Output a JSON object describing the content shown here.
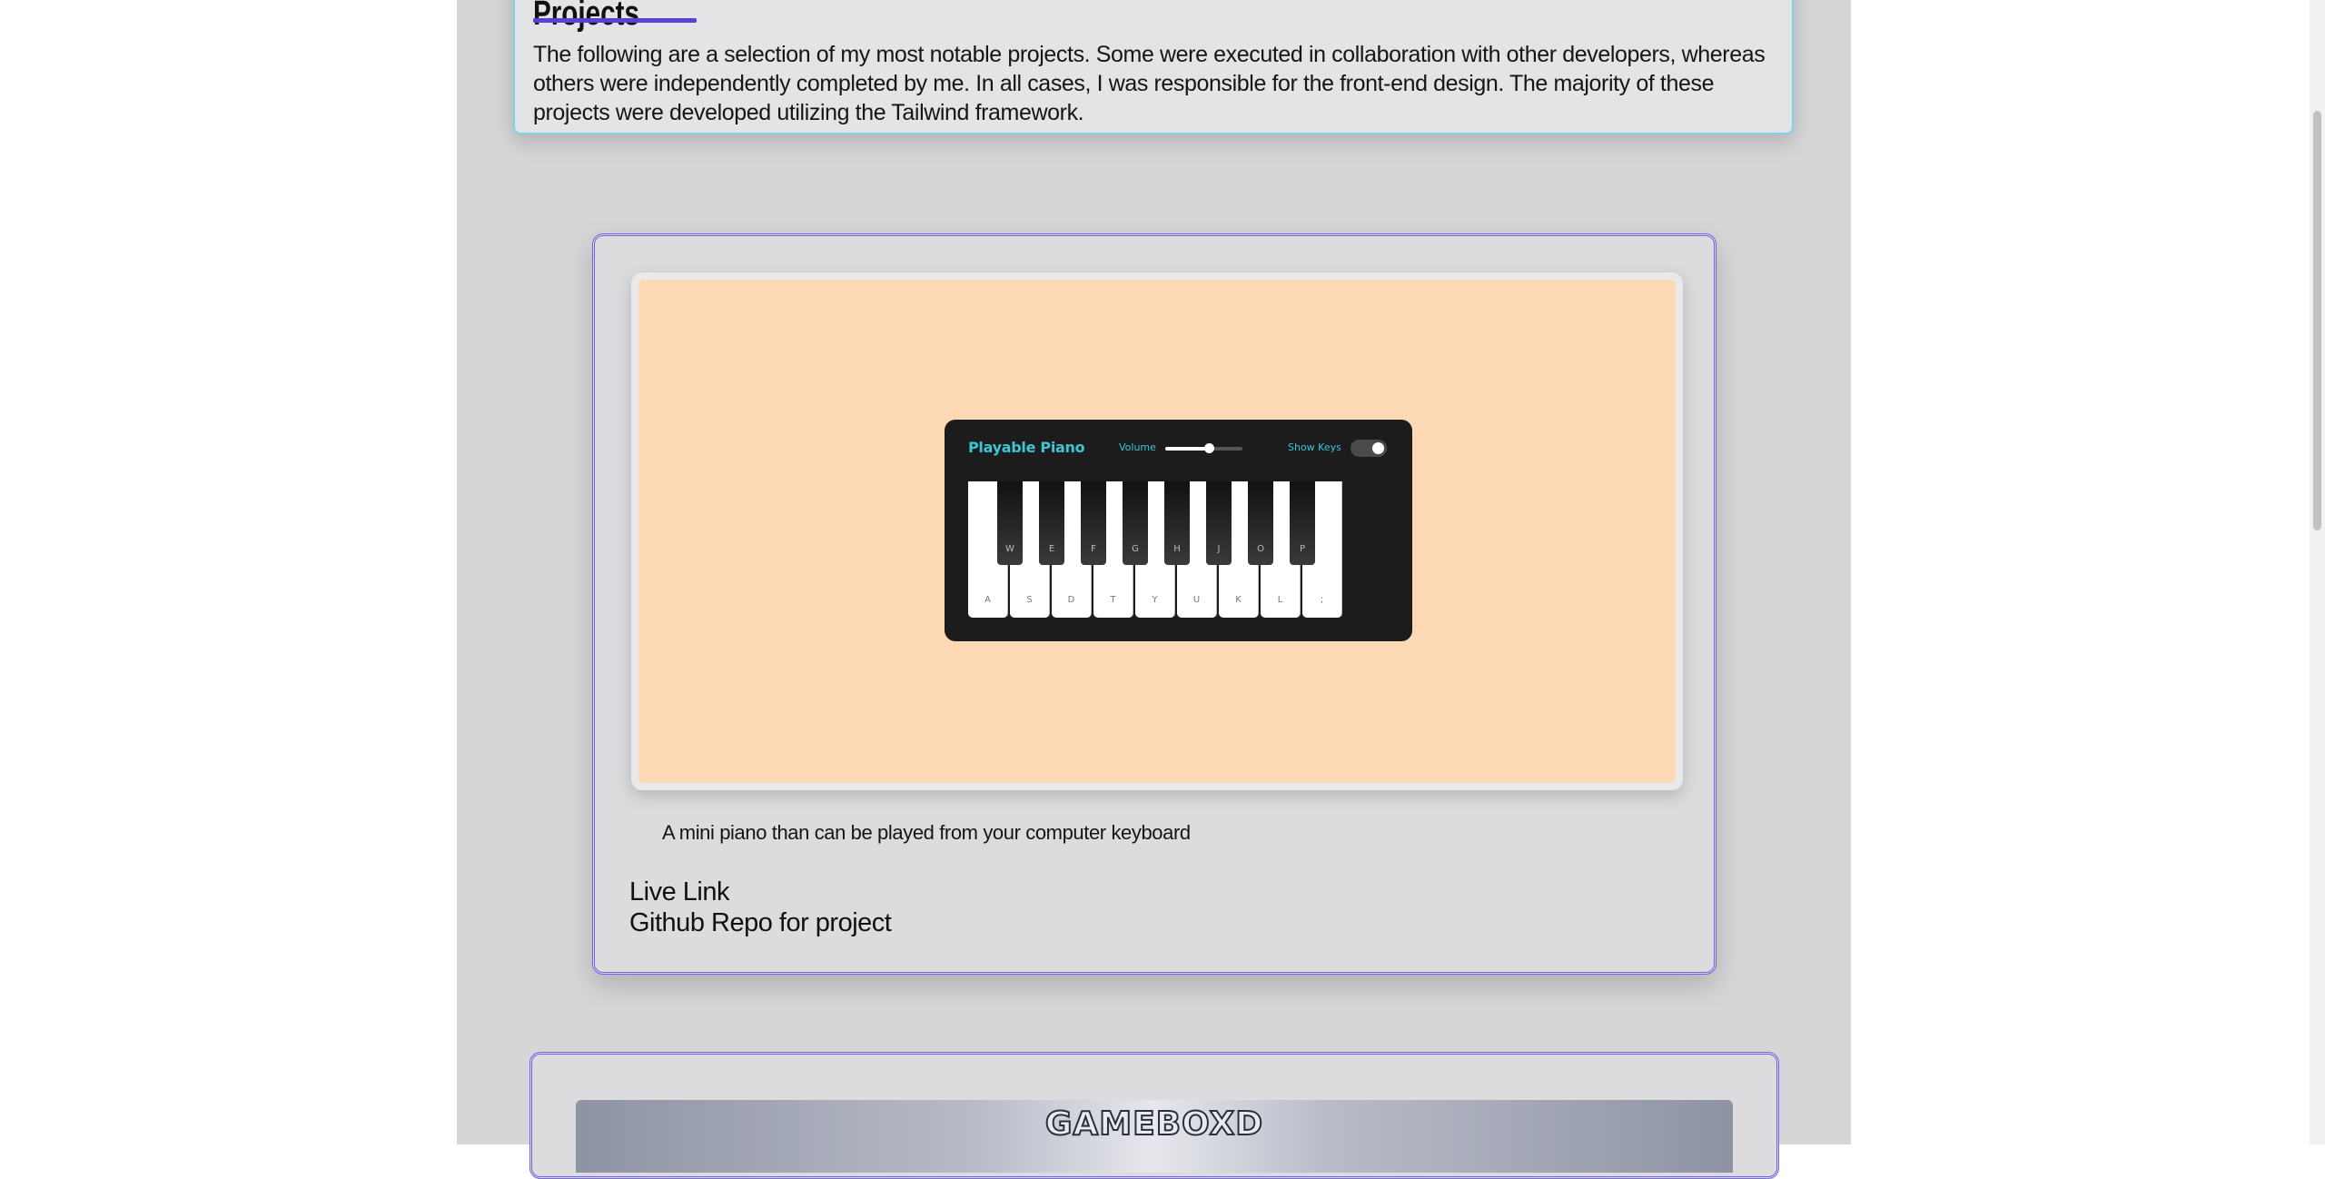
{
  "intro": {
    "title": "Projects",
    "text": "The following are a selection of my most notable projects. Some were executed in collaboration with other developers, whereas others were independently completed by me. In all cases, I was responsible for the front-end design. The majority of these projects were developed utilizing the Tailwind framework."
  },
  "project1": {
    "piano": {
      "title": "Playable Piano",
      "volume_label": "Volume",
      "volume_level": 0.58,
      "show_keys_label": "Show Keys",
      "show_keys_on": true,
      "white_keys": [
        "A",
        "S",
        "D",
        "T",
        "Y",
        "U",
        "K",
        "L",
        ";"
      ],
      "black_keys": [
        "W",
        "E",
        "F",
        "G",
        "H",
        "J",
        "O",
        "P"
      ]
    },
    "description": "A mini piano than can be played from your computer keyboard",
    "live_link": "Live Link",
    "repo_link": "Github Repo for project"
  },
  "project2": {
    "banner_title": "GAMEBOXD"
  },
  "colors": {
    "accent": "#5b3fd6",
    "card_border": "#6d63e8",
    "intro_border": "#7dd3e8",
    "preview_bg": "#fdd8b5",
    "piano_accent": "#3fc5d4"
  }
}
